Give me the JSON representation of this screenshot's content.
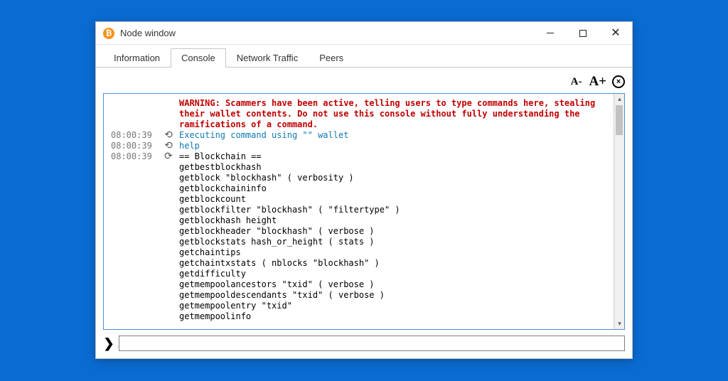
{
  "window": {
    "title": "Node window",
    "icon_name": "bitcoin-icon"
  },
  "tabs": [
    {
      "label": "Information",
      "active": false
    },
    {
      "label": "Console",
      "active": true
    },
    {
      "label": "Network Traffic",
      "active": false
    },
    {
      "label": "Peers",
      "active": false
    }
  ],
  "toolbar": {
    "font_smaller": "A-",
    "font_larger": "A+",
    "clear_label": "×"
  },
  "warning_text": "WARNING: Scammers have been active, telling users to type commands here, stealing\ntheir wallet contents. Do not use this console without fully understanding the\nramifications of a command.",
  "log": [
    {
      "time": "08:00:39",
      "icon": "⟲",
      "cls": "info",
      "text": "Executing command using \"\" wallet"
    },
    {
      "time": "08:00:39",
      "icon": "⟲",
      "cls": "info",
      "text": "help"
    },
    {
      "time": "08:00:39",
      "icon": "⟳",
      "cls": "body",
      "text": "== Blockchain ==\ngetbestblockhash\ngetblock \"blockhash\" ( verbosity )\ngetblockchaininfo\ngetblockcount\ngetblockfilter \"blockhash\" ( \"filtertype\" )\ngetblockhash height\ngetblockheader \"blockhash\" ( verbose )\ngetblockstats hash_or_height ( stats )\ngetchaintips\ngetchaintxstats ( nblocks \"blockhash\" )\ngetdifficulty\ngetmempoolancestors \"txid\" ( verbose )\ngetmempooldescendants \"txid\" ( verbose )\ngetmempoolentry \"txid\"\ngetmempoolinfo"
    }
  ],
  "input": {
    "prompt": "❯",
    "value": "",
    "placeholder": ""
  }
}
